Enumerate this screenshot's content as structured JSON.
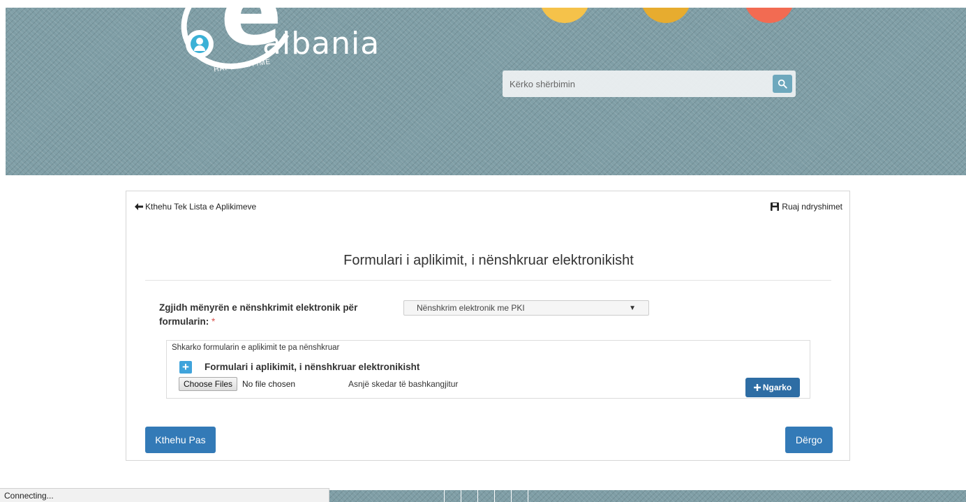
{
  "header": {
    "logo_text": "albania",
    "logo_letter": "e",
    "logo_tagline": "HAPESIRA IME",
    "search": {
      "placeholder": "Kërko shërbimin",
      "icon": "search-icon"
    }
  },
  "card": {
    "back_link": "Kthehu Tek Lista e Aplikimeve",
    "save_link": "Ruaj ndryshimet",
    "title": "Formulari i aplikimit, i nënshkruar elektronikisht",
    "signature": {
      "label": "Zgjidh mënyrën e nënshkrimit elektronik për formularin:",
      "required_mark": "*",
      "selected": "Nënshkrim elektronik me PKI"
    },
    "upload": {
      "hint": "Shkarko formularin e aplikimit te pa nënshkruar",
      "title": "Formulari i aplikimit, i nënshkruar elektronikisht",
      "choose_button": "Choose Files",
      "no_file": "No file chosen",
      "no_attachment": "Asnjë skedar të bashkangjitur",
      "upload_button": "Ngarko"
    },
    "back_button": "Kthehu Pas",
    "send_button": "Dërgo"
  },
  "status_bar": {
    "text": "Connecting..."
  },
  "colors": {
    "primary": "#337ab7",
    "header_bg": "#7f9ea6",
    "plus_icon": "#3fa3db"
  }
}
